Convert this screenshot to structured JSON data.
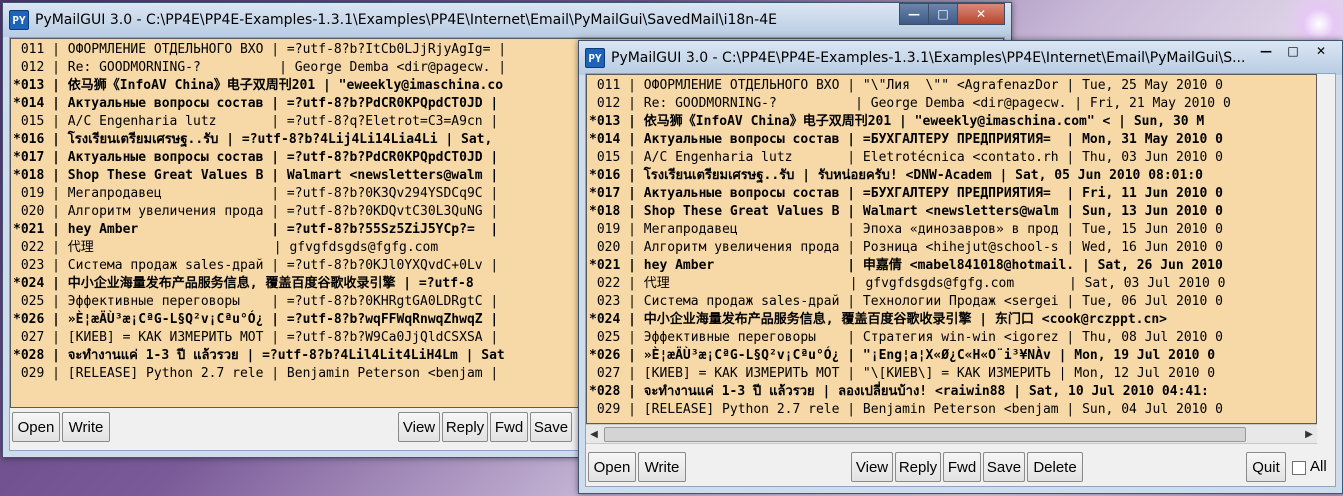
{
  "windows": [
    {
      "title": "PyMailGUI 3.0 - C:\\PP4E\\PP4E-Examples-1.3.1\\Examples\\PP4E\\Internet\\Email\\PyMailGui\\SavedMail\\i18n-4E",
      "rows": [
        {
          "text": " 011 | ОФОРМЛЕНИЕ ОТДЕЛЬНОГО ВХО | =?utf-8?b?ItCb0LJjRjyAgIg= |",
          "star": false
        },
        {
          "text": " 012 | Re: GOODMORNING-?          | George Demba <dir@pagecw. |",
          "star": false
        },
        {
          "text": "*013 | 依马狮《InfoAV China》电子双周刊201 | \"eweekly@imaschina.co",
          "star": true
        },
        {
          "text": "*014 | Актуальные вопросы состав | =?utf-8?b?PdCR0KPQpdCT0JD |",
          "star": true
        },
        {
          "text": " 015 | A/C Engenharia lutz       | =?utf-8?q?Eletrot=C3=A9cn |",
          "star": false
        },
        {
          "text": "*016 | โรงเรียนเตรียมเศรษฐ..รับ | =?utf-8?b?4Lij4Li14Lia4Li | Sat,",
          "star": true
        },
        {
          "text": "*017 | Актуальные вопросы состав | =?utf-8?b?PdCR0KPQpdCT0JD |",
          "star": true
        },
        {
          "text": "*018 | Shop These Great Values B | Walmart <newsletters@walm |",
          "star": true
        },
        {
          "text": " 019 | Мегапродавец              | =?utf-8?b?0K3Qv294YSDCq9C |",
          "star": false
        },
        {
          "text": " 020 | Алгоритм увеличения прода | =?utf-8?b?0KDQvtC30L3QuNG |",
          "star": false
        },
        {
          "text": "*021 | hey Amber                 | =?utf-8?b?55Sz5ZiJ5YCp?=  |",
          "star": true
        },
        {
          "text": " 022 | 代理                       | gfvgfdsgds@fgfg.com",
          "star": false
        },
        {
          "text": " 023 | Система продаж sales-драй | =?utf-8?b?0KJl0YXQvdC+0Lv |",
          "star": false
        },
        {
          "text": "*024 | 中小企业海量发布产品服务信息, 覆盖百度谷歌收录引擎 | =?utf-8",
          "star": true
        },
        {
          "text": " 025 | Эффективные переговоры    | =?utf-8?b?0KHRgtGA0LDRgtC |",
          "star": false
        },
        {
          "text": "*026 | »È¦æÄÙ³æ¡CªG-L§Q²v¡Cªu°Ó¿ | =?utf-8?b?wqFFWqRnwqZhwqZ |",
          "star": true
        },
        {
          "text": " 027 | [КИЕВ] = КАК ИЗМЕРИТЬ МОТ | =?utf-8?b?W9Ca0JjQldCSXSA |",
          "star": false
        },
        {
          "text": "*028 | จะทำงานแค่ 1-3 ปี แล้วรวย | =?utf-8?b?4Lil4Lit4LiH4Lm | Sat",
          "star": true
        },
        {
          "text": " 029 | [RELEASE] Python 2.7 rele | Benjamin Peterson <benjam |",
          "star": false
        }
      ],
      "buttons": {
        "open": "Open",
        "write": "Write",
        "view": "View",
        "reply": "Reply",
        "fwd": "Fwd",
        "save": "Save"
      }
    },
    {
      "title": "PyMailGUI 3.0 - C:\\PP4E\\PP4E-Examples-1.3.1\\Examples\\PP4E\\Internet\\Email\\PyMailGui\\S...",
      "rows": [
        {
          "text": " 011 | ОФОРМЛЕНИЕ ОТДЕЛЬНОГО ВХО | \"\\\"Лия  \\\"\" <AgrafenazDor | Tue, 25 May 2010 0",
          "star": false
        },
        {
          "text": " 012 | Re: GOODMORNING-?          | George Demba <dir@pagecw. | Fri, 21 May 2010 0",
          "star": false
        },
        {
          "text": "*013 | 依马狮《InfoAV China》电子双周刊201 | \"eweekly@imaschina.com\" < | Sun, 30 M",
          "star": true
        },
        {
          "text": "*014 | Актуальные вопросы состав | =БУХГАЛТЕРУ ПРЕДПРИЯТИЯ=  | Mon, 31 May 2010 0",
          "star": true
        },
        {
          "text": " 015 | A/C Engenharia lutz       | Eletrotécnica <contato.rh | Thu, 03 Jun 2010 0",
          "star": false
        },
        {
          "text": "*016 | โรงเรียนเตรียมเศรษฐ..รับ | รับหน่อยครับ! <DNW-Academ | Sat, 05 Jun 2010 08:01:0",
          "star": true
        },
        {
          "text": "*017 | Актуальные вопросы состав | =БУХГАЛТЕРУ ПРЕДПРИЯТИЯ=  | Fri, 11 Jun 2010 0",
          "star": true
        },
        {
          "text": "*018 | Shop These Great Values B | Walmart <newsletters@walm | Sun, 13 Jun 2010 0",
          "star": true
        },
        {
          "text": " 019 | Мегапродавец              | Эпоха «динозавров» в прод | Tue, 15 Jun 2010 0",
          "star": false
        },
        {
          "text": " 020 | Алгоритм увеличения прода | Розница <hihejut@school-s | Wed, 16 Jun 2010 0",
          "star": false
        },
        {
          "text": "*021 | hey Amber                 | 申嘉倩 <mabel841018@hotmail. | Sat, 26 Jun 2010",
          "star": true
        },
        {
          "text": " 022 | 代理                       | gfvgfdsgds@fgfg.com       | Sat, 03 Jul 2010 0",
          "star": false
        },
        {
          "text": " 023 | Система продаж sales-драй | Технологии Продаж <sergei | Tue, 06 Jul 2010 0",
          "star": false
        },
        {
          "text": "*024 | 中小企业海量发布产品服务信息, 覆盖百度谷歌收录引擎 | 东门口 <cook@rczppt.cn>",
          "star": true
        },
        {
          "text": " 025 | Эффективные переговоры    | Стратегия win-win <igorez | Thu, 08 Jul 2010 0",
          "star": false
        },
        {
          "text": "*026 | »È¦æÄÙ³æ¡CªG-L§Q²v¡Cªu°Ó¿ | \"¡Eng¦a¦X«Ø¿C«H«O¨i³¥NÀv | Mon, 19 Jul 2010 0",
          "star": true
        },
        {
          "text": " 027 | [КИЕВ] = КАК ИЗМЕРИТЬ МОТ | \"\\[КИЕВ\\] = КАК ИЗМЕРИТЬ | Mon, 12 Jul 2010 0",
          "star": false
        },
        {
          "text": "*028 | จะทำงานแค่ 1-3 ปี แล้วรวย | ลองเปลี่ยนบ้าง! <raiwin88 | Sat, 10 Jul 2010 04:41:",
          "star": true
        },
        {
          "text": " 029 | [RELEASE] Python 2.7 rele | Benjamin Peterson <benjam | Sun, 04 Jul 2010 0",
          "star": false
        }
      ],
      "buttons": {
        "open": "Open",
        "write": "Write",
        "view": "View",
        "reply": "Reply",
        "fwd": "Fwd",
        "save": "Save",
        "delete": "Delete",
        "quit": "Quit",
        "all": "All"
      }
    }
  ],
  "icons": {
    "app": "PY",
    "minimize": "minimize-icon",
    "maximize": "maximize-icon",
    "close": "close-icon"
  }
}
